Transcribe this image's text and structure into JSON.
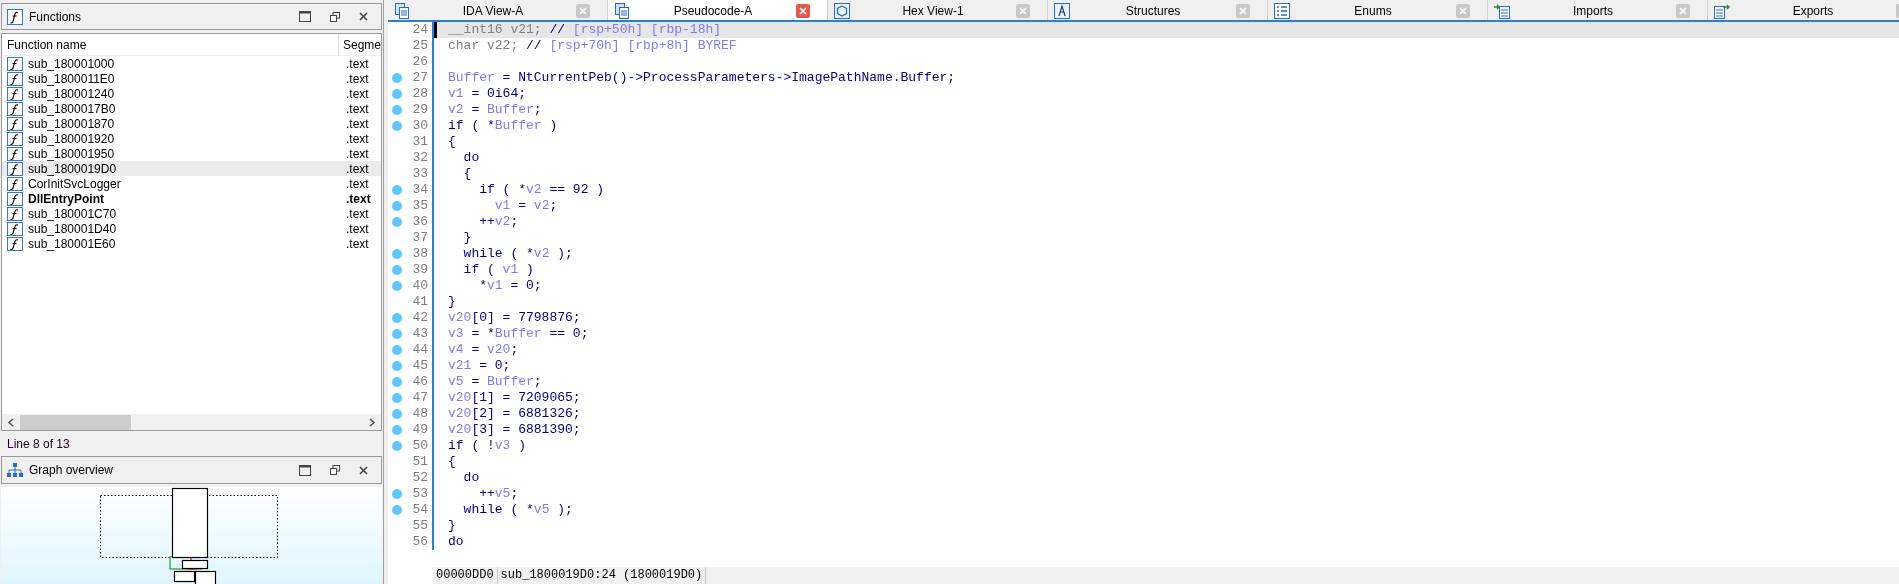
{
  "functions_panel": {
    "title": "Functions",
    "columns": [
      "Function name",
      "Segme"
    ],
    "rows": [
      {
        "name": "sub_180001000",
        "segment": ".text",
        "selected": false,
        "bold": false
      },
      {
        "name": "sub_1800011E0",
        "segment": ".text",
        "selected": false,
        "bold": false
      },
      {
        "name": "sub_180001240",
        "segment": ".text",
        "selected": false,
        "bold": false
      },
      {
        "name": "sub_1800017B0",
        "segment": ".text",
        "selected": false,
        "bold": false
      },
      {
        "name": "sub_180001870",
        "segment": ".text",
        "selected": false,
        "bold": false
      },
      {
        "name": "sub_180001920",
        "segment": ".text",
        "selected": false,
        "bold": false
      },
      {
        "name": "sub_180001950",
        "segment": ".text",
        "selected": false,
        "bold": false
      },
      {
        "name": "sub_1800019D0",
        "segment": ".text",
        "selected": true,
        "bold": false
      },
      {
        "name": "CorInitSvcLogger",
        "segment": ".text",
        "selected": false,
        "bold": false
      },
      {
        "name": "DllEntryPoint",
        "segment": ".text",
        "selected": false,
        "bold": true
      },
      {
        "name": "sub_180001C70",
        "segment": ".text",
        "selected": false,
        "bold": false
      },
      {
        "name": "sub_180001D40",
        "segment": ".text",
        "selected": false,
        "bold": false
      },
      {
        "name": "sub_180001E60",
        "segment": ".text",
        "selected": false,
        "bold": false
      }
    ],
    "status": "Line 8 of 13"
  },
  "graph_panel": {
    "title": "Graph overview"
  },
  "tabs": [
    {
      "label": "IDA View-A",
      "selected": false
    },
    {
      "label": "Pseudocode-A",
      "selected": true
    },
    {
      "label": "Hex View-1",
      "selected": false
    },
    {
      "label": "Structures",
      "selected": false
    },
    {
      "label": "Enums",
      "selected": false
    },
    {
      "label": "Imports",
      "selected": false
    },
    {
      "label": "Exports",
      "selected": false
    }
  ],
  "code_lines": [
    {
      "number": "24",
      "breakpoint": false,
      "current": true,
      "tokens": [
        {
          "text": "__int16 v21; ",
          "kind": "gray"
        },
        {
          "text": "// ",
          "kind": "plain"
        },
        {
          "text": "[rsp+50h] [rbp-18h]",
          "kind": "comment"
        }
      ]
    },
    {
      "number": "25",
      "breakpoint": false,
      "current": false,
      "tokens": [
        {
          "text": "char v22; ",
          "kind": "gray"
        },
        {
          "text": "// ",
          "kind": "plain"
        },
        {
          "text": "[rsp+70h] [rbp+8h] BYREF",
          "kind": "comment"
        }
      ]
    },
    {
      "number": "26",
      "breakpoint": false,
      "current": false
    },
    {
      "number": "27",
      "breakpoint": true,
      "current": false,
      "tokens": [
        {
          "text": "Buffer",
          "kind": "var"
        },
        {
          "text": " = NtCurrentPeb()->ProcessParameters->ImagePathName.Buffer;",
          "kind": "plain"
        }
      ]
    },
    {
      "number": "28",
      "breakpoint": true,
      "current": false,
      "tokens": [
        {
          "text": "v1",
          "kind": "var"
        },
        {
          "text": " = 0i64;",
          "kind": "plain"
        }
      ]
    },
    {
      "number": "29",
      "breakpoint": true,
      "current": false,
      "tokens": [
        {
          "text": "v2",
          "kind": "var"
        },
        {
          "text": " = ",
          "kind": "plain"
        },
        {
          "text": "Buffer",
          "kind": "var"
        },
        {
          "text": ";",
          "kind": "plain"
        }
      ]
    },
    {
      "number": "30",
      "breakpoint": true,
      "current": false,
      "tokens": [
        {
          "text": "if ( *",
          "kind": "plain"
        },
        {
          "text": "Buffer",
          "kind": "var"
        },
        {
          "text": " )",
          "kind": "plain"
        }
      ]
    },
    {
      "number": "31",
      "breakpoint": false,
      "current": false,
      "tokens": [
        {
          "text": "{",
          "kind": "plain"
        }
      ]
    },
    {
      "number": "32",
      "breakpoint": false,
      "current": false,
      "tokens": [
        {
          "text": "  do",
          "kind": "plain"
        }
      ]
    },
    {
      "number": "33",
      "breakpoint": false,
      "current": false,
      "tokens": [
        {
          "text": "  {",
          "kind": "plain"
        }
      ]
    },
    {
      "number": "34",
      "breakpoint": true,
      "current": false,
      "tokens": [
        {
          "text": "    if ( *",
          "kind": "plain"
        },
        {
          "text": "v2",
          "kind": "var"
        },
        {
          "text": " == 92 )",
          "kind": "plain"
        }
      ]
    },
    {
      "number": "35",
      "breakpoint": true,
      "current": false,
      "tokens": [
        {
          "text": "      v1",
          "kind": "var"
        },
        {
          "text": " = ",
          "kind": "plain"
        },
        {
          "text": "v2",
          "kind": "var"
        },
        {
          "text": ";",
          "kind": "plain"
        }
      ]
    },
    {
      "number": "36",
      "breakpoint": true,
      "current": false,
      "tokens": [
        {
          "text": "    ++",
          "kind": "plain"
        },
        {
          "text": "v2",
          "kind": "var"
        },
        {
          "text": ";",
          "kind": "plain"
        }
      ]
    },
    {
      "number": "37",
      "breakpoint": false,
      "current": false,
      "tokens": [
        {
          "text": "  }",
          "kind": "plain"
        }
      ]
    },
    {
      "number": "38",
      "breakpoint": true,
      "current": false,
      "tokens": [
        {
          "text": "  while ( *",
          "kind": "plain"
        },
        {
          "text": "v2",
          "kind": "var"
        },
        {
          "text": " );",
          "kind": "plain"
        }
      ]
    },
    {
      "number": "39",
      "breakpoint": true,
      "current": false,
      "tokens": [
        {
          "text": "  if ( ",
          "kind": "plain"
        },
        {
          "text": "v1",
          "kind": "var"
        },
        {
          "text": " )",
          "kind": "plain"
        }
      ]
    },
    {
      "number": "40",
      "breakpoint": true,
      "current": false,
      "tokens": [
        {
          "text": "    *",
          "kind": "plain"
        },
        {
          "text": "v1",
          "kind": "var"
        },
        {
          "text": " = 0;",
          "kind": "plain"
        }
      ]
    },
    {
      "number": "41",
      "breakpoint": false,
      "current": false,
      "tokens": [
        {
          "text": "}",
          "kind": "plain"
        }
      ]
    },
    {
      "number": "42",
      "breakpoint": true,
      "current": false,
      "tokens": [
        {
          "text": "v20",
          "kind": "var"
        },
        {
          "text": "[0] = 7798876;",
          "kind": "plain"
        }
      ]
    },
    {
      "number": "43",
      "breakpoint": true,
      "current": false,
      "tokens": [
        {
          "text": "v3",
          "kind": "var"
        },
        {
          "text": " = *",
          "kind": "plain"
        },
        {
          "text": "Buffer",
          "kind": "var"
        },
        {
          "text": " == 0;",
          "kind": "plain"
        }
      ]
    },
    {
      "number": "44",
      "breakpoint": true,
      "current": false,
      "tokens": [
        {
          "text": "v4",
          "kind": "var"
        },
        {
          "text": " = ",
          "kind": "plain"
        },
        {
          "text": "v20",
          "kind": "var"
        },
        {
          "text": ";",
          "kind": "plain"
        }
      ]
    },
    {
      "number": "45",
      "breakpoint": true,
      "current": false,
      "tokens": [
        {
          "text": "v21",
          "kind": "var"
        },
        {
          "text": " = 0;",
          "kind": "plain"
        }
      ]
    },
    {
      "number": "46",
      "breakpoint": true,
      "current": false,
      "tokens": [
        {
          "text": "v5",
          "kind": "var"
        },
        {
          "text": " = ",
          "kind": "plain"
        },
        {
          "text": "Buffer",
          "kind": "var"
        },
        {
          "text": ";",
          "kind": "plain"
        }
      ]
    },
    {
      "number": "47",
      "breakpoint": true,
      "current": false,
      "tokens": [
        {
          "text": "v20",
          "kind": "var"
        },
        {
          "text": "[1] = 7209065;",
          "kind": "plain"
        }
      ]
    },
    {
      "number": "48",
      "breakpoint": true,
      "current": false,
      "tokens": [
        {
          "text": "v20",
          "kind": "var"
        },
        {
          "text": "[2] = 6881326;",
          "kind": "plain"
        }
      ]
    },
    {
      "number": "49",
      "breakpoint": true,
      "current": false,
      "tokens": [
        {
          "text": "v20",
          "kind": "var"
        },
        {
          "text": "[3] = 6881390;",
          "kind": "plain"
        }
      ]
    },
    {
      "number": "50",
      "breakpoint": true,
      "current": false,
      "tokens": [
        {
          "text": "if ( !",
          "kind": "plain"
        },
        {
          "text": "v3",
          "kind": "var"
        },
        {
          "text": " )",
          "kind": "plain"
        }
      ]
    },
    {
      "number": "51",
      "breakpoint": false,
      "current": false,
      "tokens": [
        {
          "text": "{",
          "kind": "plain"
        }
      ]
    },
    {
      "number": "52",
      "breakpoint": false,
      "current": false,
      "tokens": [
        {
          "text": "  do",
          "kind": "plain"
        }
      ]
    },
    {
      "number": "53",
      "breakpoint": true,
      "current": false,
      "tokens": [
        {
          "text": "    ++",
          "kind": "plain"
        },
        {
          "text": "v5",
          "kind": "var"
        },
        {
          "text": ";",
          "kind": "plain"
        }
      ]
    },
    {
      "number": "54",
      "breakpoint": true,
      "current": false,
      "tokens": [
        {
          "text": "  while ( *",
          "kind": "plain"
        },
        {
          "text": "v5",
          "kind": "var"
        },
        {
          "text": " );",
          "kind": "plain"
        }
      ]
    },
    {
      "number": "55",
      "breakpoint": false,
      "current": false,
      "tokens": [
        {
          "text": "}",
          "kind": "plain"
        }
      ]
    },
    {
      "number": "56",
      "breakpoint": false,
      "current": false,
      "tokens": [
        {
          "text": "do",
          "kind": "plain"
        }
      ]
    }
  ],
  "status_bar": [
    "00000DD0",
    "sub_1800019D0:24 (1800019D0)"
  ]
}
